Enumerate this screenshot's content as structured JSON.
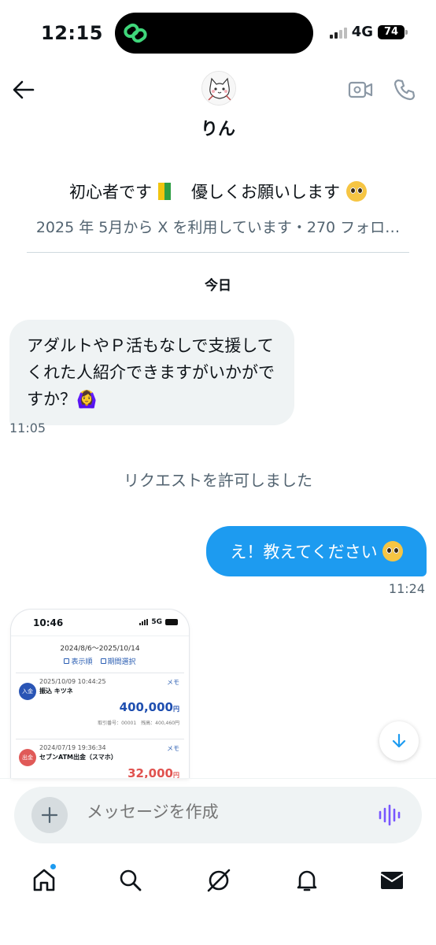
{
  "status_bar": {
    "time": "12:15",
    "network": "4G",
    "battery": "74"
  },
  "header": {
    "name": "りん"
  },
  "profile": {
    "bio_text": "初心者です",
    "bio_text2": "優しくお願いします",
    "meta": "2025 年 5月から X を利用しています・270 フォロ…"
  },
  "conversation": {
    "date_label": "今日",
    "incoming": {
      "text": "アダルトやＰ活もなしで支援してくれた人紹介できますがいかがですか？🙆‍♀️",
      "time": "11:05"
    },
    "system": "リクエストを許可しました",
    "outgoing": {
      "text": "え！教えてください",
      "time": "11:24"
    }
  },
  "attachment": {
    "time": "10:46",
    "network": "5G",
    "range": "2024/8/6〜2025/10/14",
    "tool_display": "表示順",
    "tool_period": "期間選択",
    "entries": [
      {
        "badge": "入金",
        "badge_color": "#2a55b5",
        "date": "2025/10/09 10:44:25",
        "name": "振込 キツネ",
        "memo": "メモ",
        "amount": "400,000",
        "unit": "円",
        "amount_color": "#1f4fb0",
        "footer": "取引番号：00001　残高：400,460円"
      },
      {
        "badge": "出金",
        "badge_color": "#e05a58",
        "date": "2024/07/19 19:36:34",
        "name": "セブンATM出金（スマホ）",
        "memo": "メモ",
        "amount": "32,000",
        "unit": "円",
        "amount_color": "#e0524f",
        "footer": ""
      }
    ]
  },
  "composer": {
    "placeholder": "メッセージを作成"
  },
  "colors": {
    "accent": "#1d9bf0",
    "bubble_in": "#eff3f4",
    "muted": "#536471",
    "voice": "#7856ff"
  }
}
